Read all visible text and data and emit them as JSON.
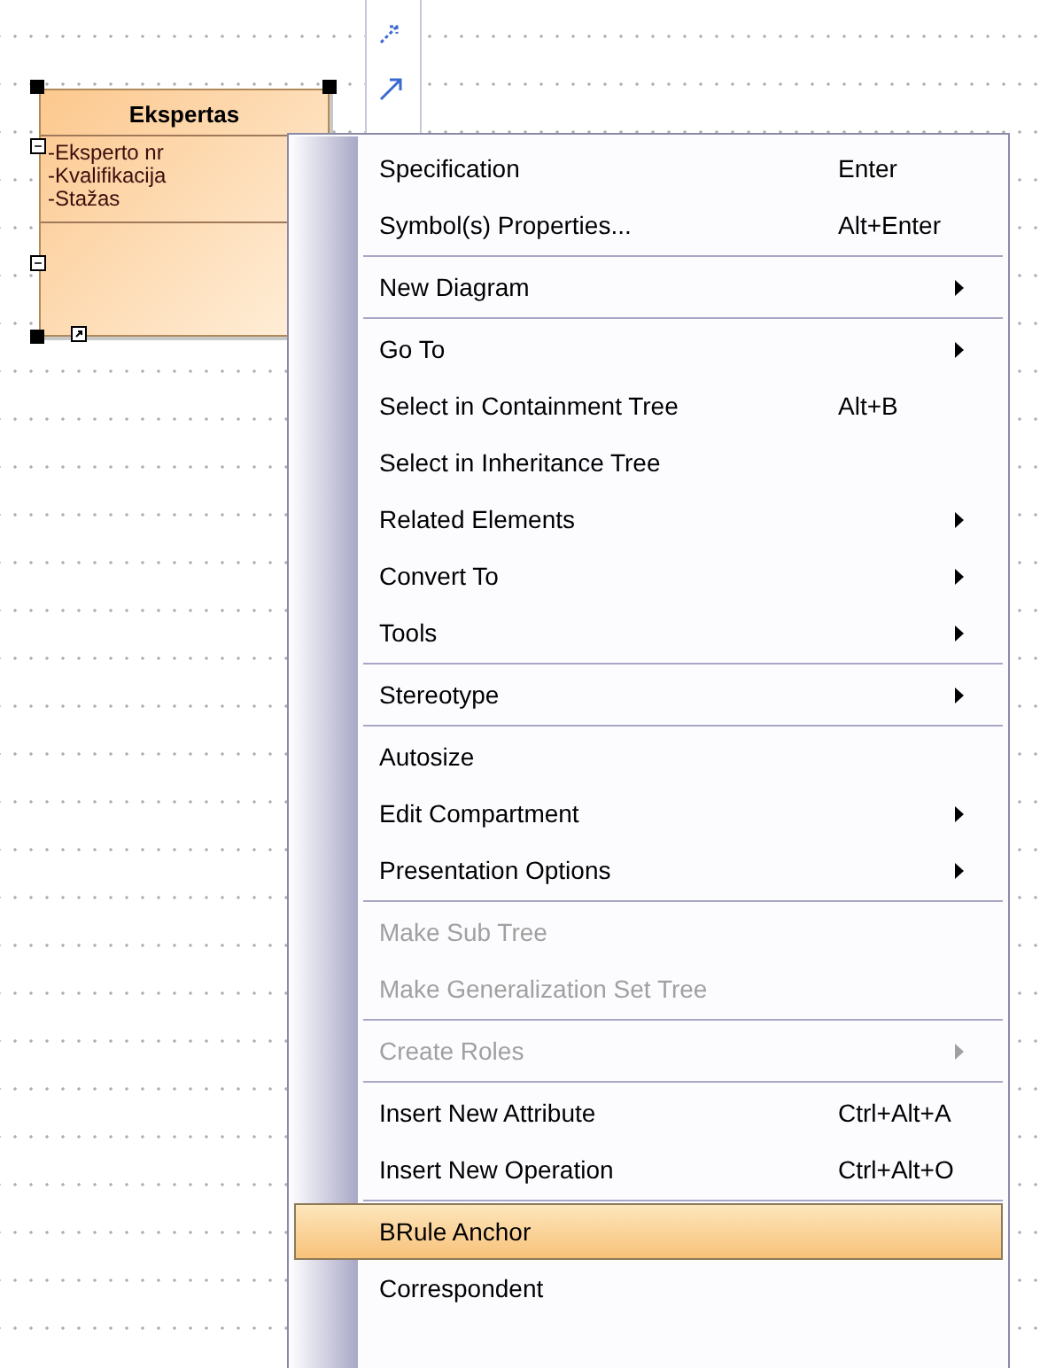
{
  "diagram": {
    "class": {
      "name": "Ekspertas",
      "attributes": [
        "-Eksperto nr",
        "-Kvalifikacija",
        "-Stažas"
      ],
      "selected": true
    }
  },
  "context_menu": {
    "items": [
      {
        "kind": "item",
        "label": "Specification",
        "shortcut": "Enter",
        "submenu": false,
        "disabled": false,
        "selected": false
      },
      {
        "kind": "item",
        "label": "Symbol(s) Properties...",
        "shortcut": "Alt+Enter",
        "submenu": false,
        "disabled": false,
        "selected": false
      },
      {
        "kind": "separator"
      },
      {
        "kind": "item",
        "label": "New Diagram",
        "submenu": true,
        "disabled": false,
        "selected": false
      },
      {
        "kind": "separator"
      },
      {
        "kind": "item",
        "label": "Go To",
        "submenu": true,
        "disabled": false,
        "selected": false
      },
      {
        "kind": "item",
        "label": "Select in Containment Tree",
        "shortcut": "Alt+B",
        "submenu": false,
        "disabled": false,
        "selected": false
      },
      {
        "kind": "item",
        "label": "Select in Inheritance Tree",
        "submenu": false,
        "disabled": false,
        "selected": false
      },
      {
        "kind": "item",
        "label": "Related Elements",
        "submenu": true,
        "disabled": false,
        "selected": false
      },
      {
        "kind": "item",
        "label": "Convert To",
        "submenu": true,
        "disabled": false,
        "selected": false
      },
      {
        "kind": "item",
        "label": "Tools",
        "submenu": true,
        "disabled": false,
        "selected": false
      },
      {
        "kind": "separator"
      },
      {
        "kind": "item",
        "label": "Stereotype",
        "submenu": true,
        "disabled": false,
        "selected": false
      },
      {
        "kind": "separator"
      },
      {
        "kind": "item",
        "label": "Autosize",
        "submenu": false,
        "disabled": false,
        "selected": false
      },
      {
        "kind": "item",
        "label": "Edit Compartment",
        "submenu": true,
        "disabled": false,
        "selected": false
      },
      {
        "kind": "item",
        "label": "Presentation Options",
        "submenu": true,
        "disabled": false,
        "selected": false
      },
      {
        "kind": "separator"
      },
      {
        "kind": "item",
        "label": "Make Sub Tree",
        "submenu": false,
        "disabled": true,
        "selected": false
      },
      {
        "kind": "item",
        "label": "Make Generalization Set Tree",
        "submenu": false,
        "disabled": true,
        "selected": false
      },
      {
        "kind": "separator"
      },
      {
        "kind": "item",
        "label": "Create Roles",
        "submenu": true,
        "disabled": true,
        "selected": false
      },
      {
        "kind": "separator"
      },
      {
        "kind": "item",
        "label": "Insert New Attribute",
        "shortcut": "Ctrl+Alt+A",
        "submenu": false,
        "disabled": false,
        "selected": false
      },
      {
        "kind": "item",
        "label": "Insert New Operation",
        "shortcut": "Ctrl+Alt+O",
        "submenu": false,
        "disabled": false,
        "selected": false
      },
      {
        "kind": "separator"
      },
      {
        "kind": "item",
        "label": "BRule Anchor",
        "submenu": false,
        "disabled": false,
        "selected": true
      },
      {
        "kind": "item",
        "label": "Correspondent",
        "submenu": false,
        "disabled": false,
        "selected": false
      }
    ]
  }
}
